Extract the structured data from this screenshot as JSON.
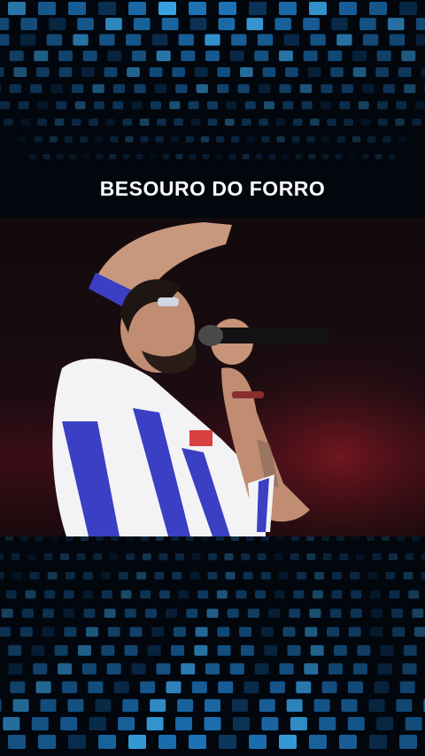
{
  "title": "BESOURO DO FORRO",
  "colors": {
    "background": "#02060d",
    "tile_bright": "#3fb6ff",
    "tile_mid": "#1f7bc4",
    "tile_dim": "#0d3a63",
    "title_text": "#ffffff"
  },
  "photo": {
    "subject": "singer-with-microphone",
    "shirt_color": "#f3f3f6",
    "shirt_stripes": "#3a3fc4"
  }
}
